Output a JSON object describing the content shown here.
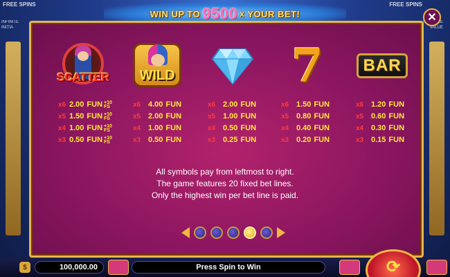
{
  "background": {
    "left_label": "FREE SPINS",
    "left_sub": [
      "INFINITE",
      "INITIA"
    ],
    "right_label": "FREE SPINS",
    "right_sub": [
      "MULTIPLE",
      "VALUE"
    ]
  },
  "banner": {
    "prefix": "WIN UP TO",
    "amount": "9500",
    "x": "x",
    "suffix": "YOUR BET!"
  },
  "close": {
    "icon": "close-icon",
    "glyph": "✕"
  },
  "symbols": [
    {
      "name": "scatter",
      "label": "SCATTER"
    },
    {
      "name": "wild",
      "label": "WILD"
    },
    {
      "name": "diamond",
      "label": ""
    },
    {
      "name": "seven",
      "label": "7"
    },
    {
      "name": "bar",
      "label": "BAR"
    }
  ],
  "paytables": [
    {
      "symbol": "scatter",
      "rows": [
        {
          "mult": "x6",
          "value": "2.00",
          "unit": "FUN",
          "extra_top": "+10",
          "extra_bottom": "FS"
        },
        {
          "mult": "x5",
          "value": "1.50",
          "unit": "FUN",
          "extra_top": "+10",
          "extra_bottom": "FS"
        },
        {
          "mult": "x4",
          "value": "1.00",
          "unit": "FUN",
          "extra_top": "+10",
          "extra_bottom": "FS"
        },
        {
          "mult": "x3",
          "value": "0.50",
          "unit": "FUN",
          "extra_top": "+10",
          "extra_bottom": "FS"
        }
      ]
    },
    {
      "symbol": "wild",
      "rows": [
        {
          "mult": "x6",
          "value": "4.00",
          "unit": "FUN"
        },
        {
          "mult": "x5",
          "value": "2.00",
          "unit": "FUN"
        },
        {
          "mult": "x4",
          "value": "1.00",
          "unit": "FUN"
        },
        {
          "mult": "x3",
          "value": "0.50",
          "unit": "FUN"
        }
      ]
    },
    {
      "symbol": "diamond",
      "rows": [
        {
          "mult": "x6",
          "value": "2.00",
          "unit": "FUN"
        },
        {
          "mult": "x5",
          "value": "1.00",
          "unit": "FUN"
        },
        {
          "mult": "x4",
          "value": "0.50",
          "unit": "FUN"
        },
        {
          "mult": "x3",
          "value": "0.25",
          "unit": "FUN"
        }
      ]
    },
    {
      "symbol": "seven",
      "rows": [
        {
          "mult": "x6",
          "value": "1.50",
          "unit": "FUN"
        },
        {
          "mult": "x5",
          "value": "0.80",
          "unit": "FUN"
        },
        {
          "mult": "x4",
          "value": "0.40",
          "unit": "FUN"
        },
        {
          "mult": "x3",
          "value": "0.20",
          "unit": "FUN"
        }
      ]
    },
    {
      "symbol": "bar",
      "rows": [
        {
          "mult": "x6",
          "value": "1.20",
          "unit": "FUN"
        },
        {
          "mult": "x5",
          "value": "0.60",
          "unit": "FUN"
        },
        {
          "mult": "x4",
          "value": "0.30",
          "unit": "FUN"
        },
        {
          "mult": "x3",
          "value": "0.15",
          "unit": "FUN"
        }
      ]
    }
  ],
  "info": [
    "All symbols pay from leftmost to right.",
    "The game features 20 fixed bet lines.",
    "Only the highest win per bet line is paid."
  ],
  "pager": {
    "total_pages": 5,
    "active_page": 4
  },
  "bottom": {
    "coin_icon": "$",
    "balance": "100,000.00",
    "status": "Press Spin to Win",
    "spin_icon": "refresh-icon",
    "spin_glyph": "⟳"
  },
  "colors": {
    "modal": "#8c1660",
    "border": "#e6b64e",
    "multiplier": "#ff3b3b",
    "value": "#ffe93a"
  }
}
